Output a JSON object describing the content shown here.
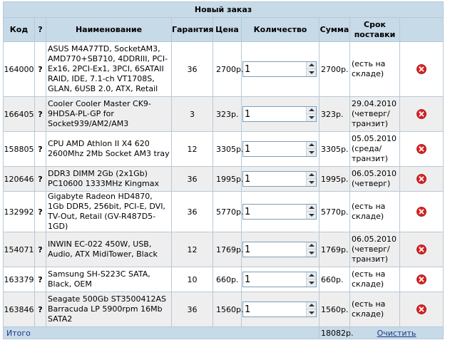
{
  "table": {
    "title": "Новый заказ",
    "headers": {
      "code": "Код",
      "question": "?",
      "name": "Наименование",
      "warranty": "Гарантия",
      "price": "Цена",
      "quantity": "Количество",
      "sum": "Сумма",
      "term": "Срок поставки"
    },
    "rows": [
      {
        "code": "164000",
        "q": "?",
        "name": "ASUS M4A77TD, SocketAM3, AMD770+SB710, 4DDRIII, PCI-Ex16, 2PCI-Ex1, 3PCI, 6SATAII RAID, IDE, 7.1-ch VT1708S, GLAN, 6USB 2.0, ATX, Retail",
        "warranty": "36",
        "price": "2700р.",
        "qty": "1",
        "sum": "2700р.",
        "term": "(есть на складе)"
      },
      {
        "code": "166405",
        "q": "?",
        "name": "Cooler Cooler Master CK9-9HDSA-PL-GP for Socket939/AM2/AM3",
        "warranty": "3",
        "price": "323р.",
        "qty": "1",
        "sum": "323р.",
        "term": "29.04.2010 (четверг/ транзит)"
      },
      {
        "code": "158805",
        "q": "?",
        "name": "CPU AMD Athlon II X4 620 2600Mhz 2Mb Socket AM3 tray",
        "warranty": "12",
        "price": "3305р.",
        "qty": "1",
        "sum": "3305р.",
        "term": "05.05.2010 (среда/ транзит)"
      },
      {
        "code": "120646",
        "q": "?",
        "name": "DDR3 DIMM 2Gb (2x1Gb) PC10600 1333MHz Kingmax",
        "warranty": "36",
        "price": "1995р.",
        "qty": "1",
        "sum": "1995р.",
        "term": "06.05.2010 (четверг)"
      },
      {
        "code": "132992",
        "q": "?",
        "name": "Gigabyte Radeon HD4870, 1Gb DDR5, 256bit, PCI-E, DVI, TV-Out, Retail (GV-R487D5-1GD)",
        "warranty": "36",
        "price": "5770р.",
        "qty": "1",
        "sum": "5770р.",
        "term": "(есть на складе)"
      },
      {
        "code": "154071",
        "q": "?",
        "name": "INWIN EC-022 450W, USB, Audio, ATX MidiTower, Black",
        "warranty": "12",
        "price": "1769р.",
        "qty": "1",
        "sum": "1769р.",
        "term": "06.05.2010 (четверг/ транзит)"
      },
      {
        "code": "163379",
        "q": "?",
        "name": "Samsung SH-S223C SATA, Black, OEM",
        "warranty": "10",
        "price": "660р.",
        "qty": "1",
        "sum": "660р.",
        "term": "(есть на складе)"
      },
      {
        "code": "163846",
        "q": "?",
        "name": "Seagate 500Gb ST3500412AS Barracuda LP 5900rpm 16Mb SATA2",
        "warranty": "36",
        "price": "1560р.",
        "qty": "1",
        "sum": "1560р.",
        "term": "(есть на складе)"
      }
    ],
    "row_heights": [],
    "footer": {
      "label": "Итого",
      "total": "18082р.",
      "clear": "Очистить"
    },
    "icons": {
      "delete": "delete-icon",
      "spin_up": "arrow-up-icon",
      "spin_down": "arrow-down-icon"
    },
    "colors": {
      "header_bg": "#c7dae8",
      "border": "#b7c9d7",
      "stripe": "#eeeeee",
      "delete_red": "#d81e1e",
      "link": "#1a3a8a"
    }
  }
}
